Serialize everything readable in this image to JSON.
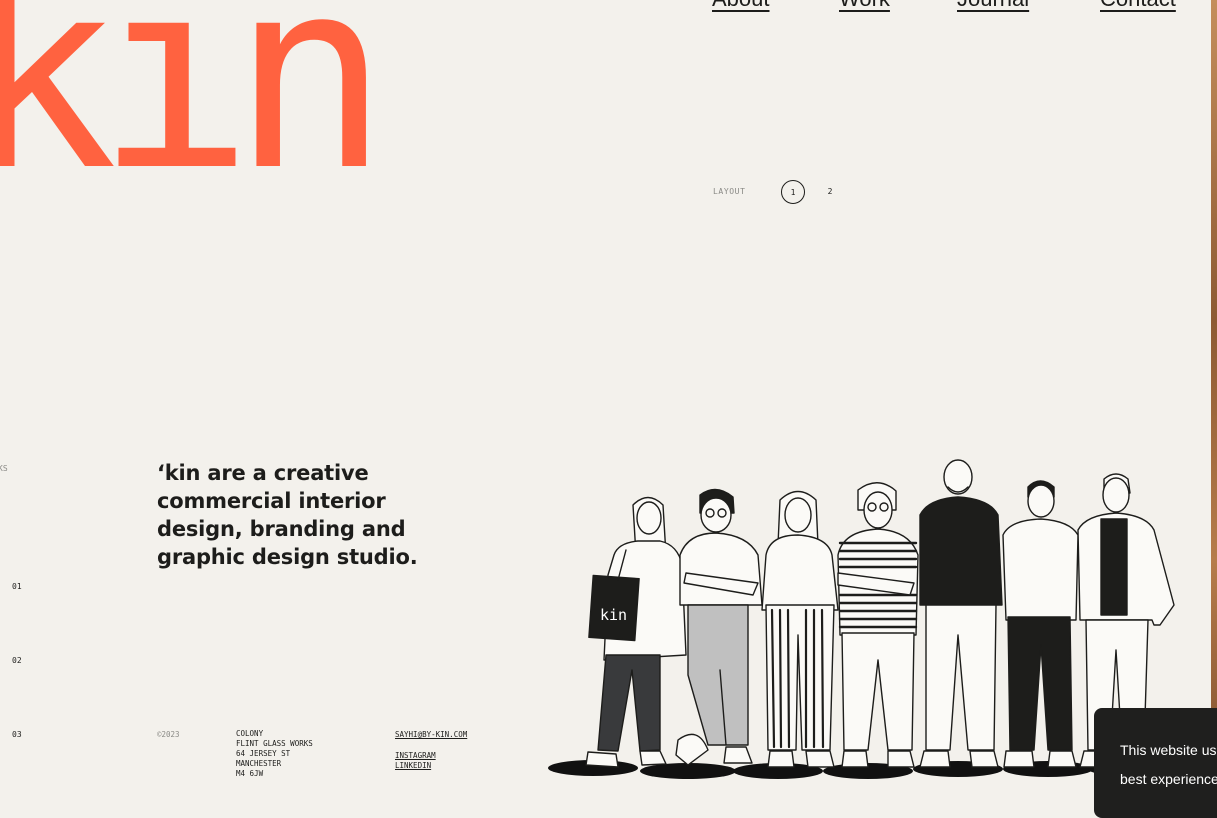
{
  "brand": {
    "logo_text": "kin",
    "accent": "#ff6240"
  },
  "nav": {
    "items": [
      "About",
      "Work",
      "Journal",
      "Contact"
    ]
  },
  "layout": {
    "label": "LAYOUT",
    "options": [
      "1",
      "2"
    ],
    "active": "1"
  },
  "sidebar": {
    "label": "KS",
    "numbers": [
      "01",
      "02",
      "03"
    ]
  },
  "intro": {
    "tagline": "‘kin are a creative commercial interior design, branding and graphic design studio."
  },
  "footer": {
    "copyright": "©2023",
    "address": [
      "COLONY",
      "FLINT GLASS WORKS",
      "64 JERSEY ST",
      "MANCHESTER",
      "M4 6JW"
    ],
    "email": "SAYHI@BY-KIN.COM",
    "instagram": "INSTAGRAM",
    "linkedin": "LINKEDIN"
  },
  "illustration": {
    "bag_text": "kin"
  },
  "cookie": {
    "line1": "This website use",
    "line2": "best experience"
  }
}
